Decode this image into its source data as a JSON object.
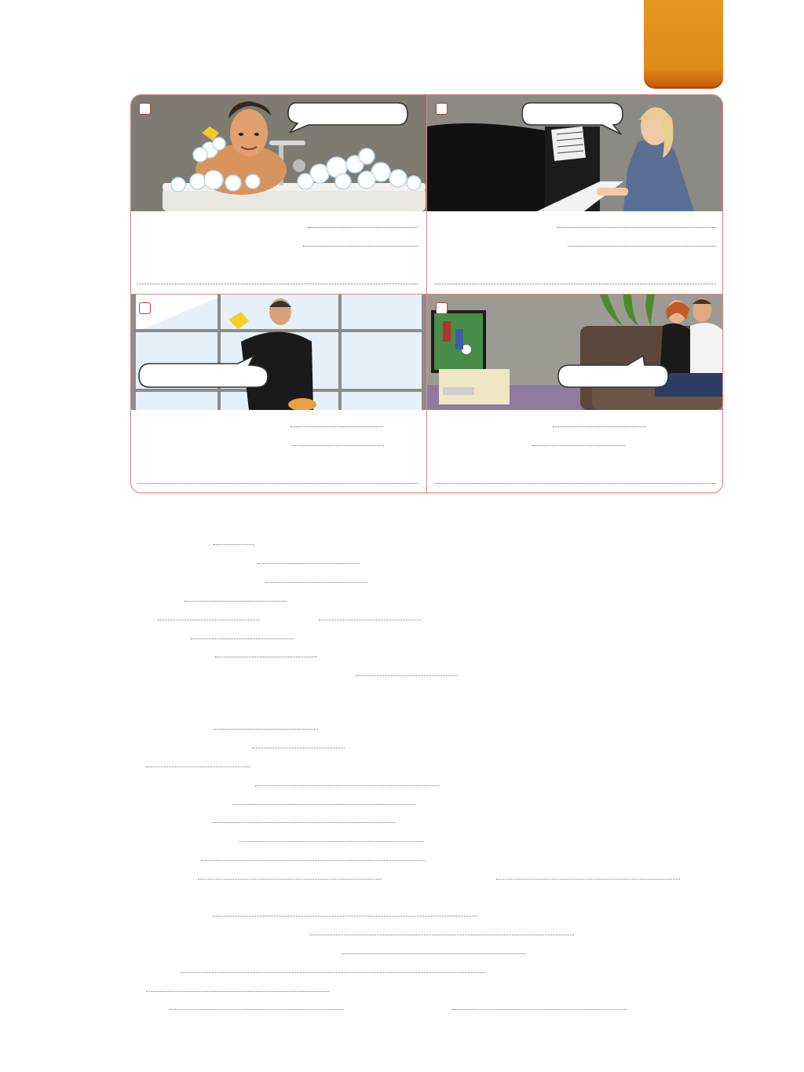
{
  "page": {
    "accent_tab_color": "#e08a1a",
    "panel_border_color": "#d98a8a",
    "checkbox_color": "#c0393b"
  },
  "panels": [
    {
      "scene": "man-in-bubble-bath",
      "speech_bubble_text": ""
    },
    {
      "scene": "woman-playing-piano",
      "speech_bubble_text": ""
    },
    {
      "scene": "man-washing-window",
      "speech_bubble_text": ""
    },
    {
      "scene": "couple-watching-football-on-tv",
      "speech_bubble_text": ""
    }
  ],
  "icons": {
    "checkbox": "checkbox-icon",
    "speech_bubble": "speech-bubble-icon"
  }
}
